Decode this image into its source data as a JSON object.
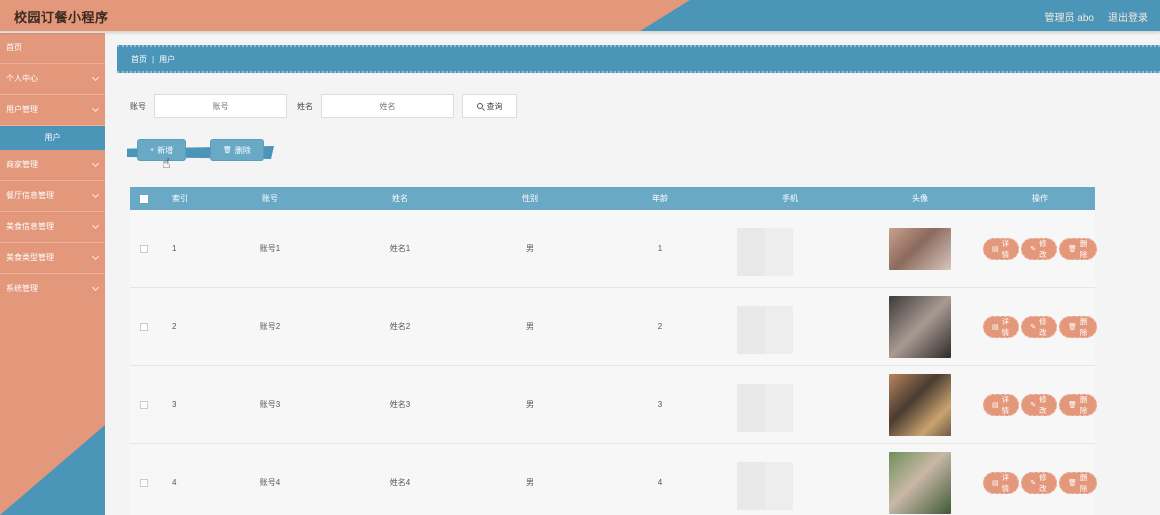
{
  "header": {
    "title": "校园订餐小程序",
    "admin": "管理员 abo",
    "logout": "退出登录"
  },
  "sidebar": {
    "items": [
      {
        "label": "首页"
      },
      {
        "label": "个人中心"
      },
      {
        "label": "用户管理"
      },
      {
        "label": "用户"
      },
      {
        "label": "商家管理"
      },
      {
        "label": "餐厅信息管理"
      },
      {
        "label": "美食信息管理"
      },
      {
        "label": "美食类型管理"
      },
      {
        "label": "系统管理"
      }
    ]
  },
  "breadcrumb": {
    "home": "首页",
    "current": "用户"
  },
  "search": {
    "account_label": "账号",
    "account_placeholder": "账号",
    "name_label": "姓名",
    "name_placeholder": "姓名",
    "query_label": "查询"
  },
  "actions": {
    "add_label": "新增",
    "delete_label": "删除"
  },
  "table": {
    "headers": {
      "index": "索引",
      "account": "账号",
      "name": "姓名",
      "gender": "性别",
      "age": "年龄",
      "phone": "手机",
      "avatar": "头像",
      "ops": "操作"
    },
    "rows": [
      {
        "index": "1",
        "account": "账号1",
        "name": "姓名1",
        "gender": "男",
        "age": "1"
      },
      {
        "index": "2",
        "account": "账号2",
        "name": "姓名2",
        "gender": "男",
        "age": "2"
      },
      {
        "index": "3",
        "account": "账号3",
        "name": "姓名3",
        "gender": "男",
        "age": "3"
      },
      {
        "index": "4",
        "account": "账号4",
        "name": "姓名4",
        "gender": "男",
        "age": "4"
      }
    ],
    "ops": {
      "detail": "详情",
      "edit": "修改",
      "delete": "删除"
    }
  },
  "colors": {
    "primary": "#4b95b9",
    "accent": "#e3977b",
    "table_header": "#6aa9c6"
  }
}
